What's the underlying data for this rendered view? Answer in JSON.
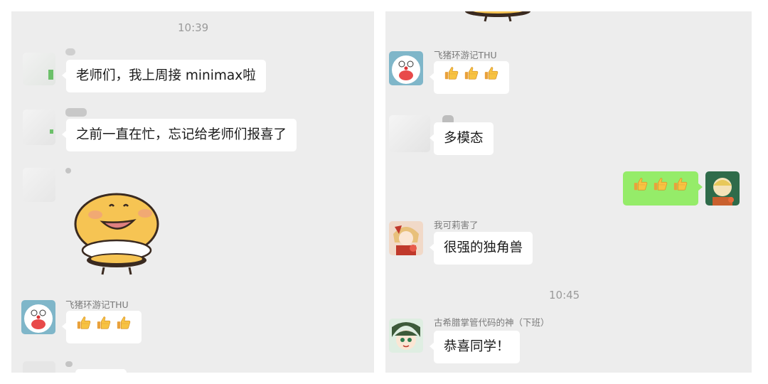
{
  "left": {
    "time": "10:39",
    "messages": [
      {
        "sender": "",
        "text": "老师们，我上周接 minimax啦"
      },
      {
        "sender": "",
        "text": "之前一直在忙，忘记给老师们报喜了"
      },
      {
        "sender": "",
        "sticker": "bee-sticker"
      },
      {
        "sender": "飞猪环游记THU",
        "text": "👍👍👍"
      }
    ]
  },
  "right": {
    "messages": [
      {
        "sender": "飞猪环游记THU",
        "text": "👍👍👍"
      },
      {
        "sender": "",
        "text": "多模态"
      },
      {
        "sender": "me",
        "text": "👍👍👍"
      },
      {
        "sender": "我可莉害了",
        "text": "很强的独角兽"
      }
    ],
    "time": "10:45",
    "last": {
      "sender": "古希腊掌管代码的神（下班）",
      "text": "恭喜同学！"
    }
  },
  "colors": {
    "panel_bg": "#ededed",
    "bubble": "#ffffff",
    "my_bubble": "#95ec69",
    "time": "#9a9a9a"
  },
  "icons": [
    "thumbs-up-icon",
    "bee-sticker",
    "doraemon-avatar",
    "anime-avatar"
  ]
}
